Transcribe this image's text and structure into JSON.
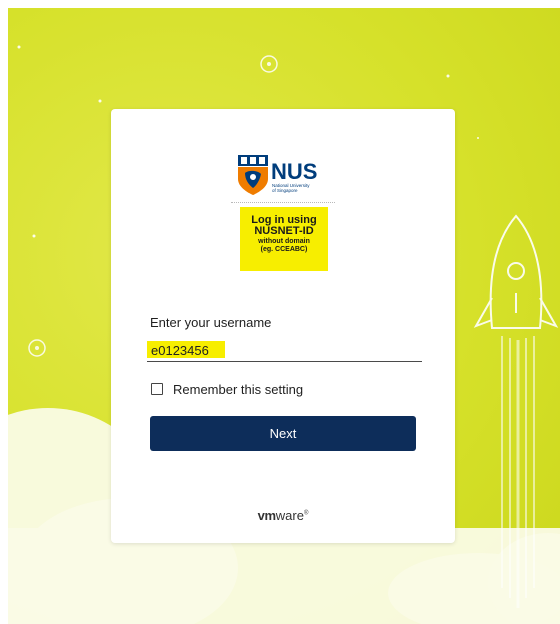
{
  "login": {
    "note": {
      "line1": "Log in using",
      "line2": "NUSNET-ID",
      "line3": "without domain",
      "line4": "(eg. CCEABC)"
    },
    "username_label": "Enter your username",
    "username_value": "e0123456",
    "remember_label": "Remember this setting",
    "next_label": "Next"
  },
  "branding": {
    "logo_text": "NUS",
    "logo_subtext_1": "National University",
    "logo_subtext_2": "of Singapore",
    "footer_vm": "vm",
    "footer_ware": "ware",
    "footer_reg": "®"
  },
  "colors": {
    "background": "#d6e12a",
    "button": "#0d2d5a",
    "highlight": "#f7ee00",
    "nus_blue": "#003d7c",
    "nus_orange": "#ef7c00"
  }
}
